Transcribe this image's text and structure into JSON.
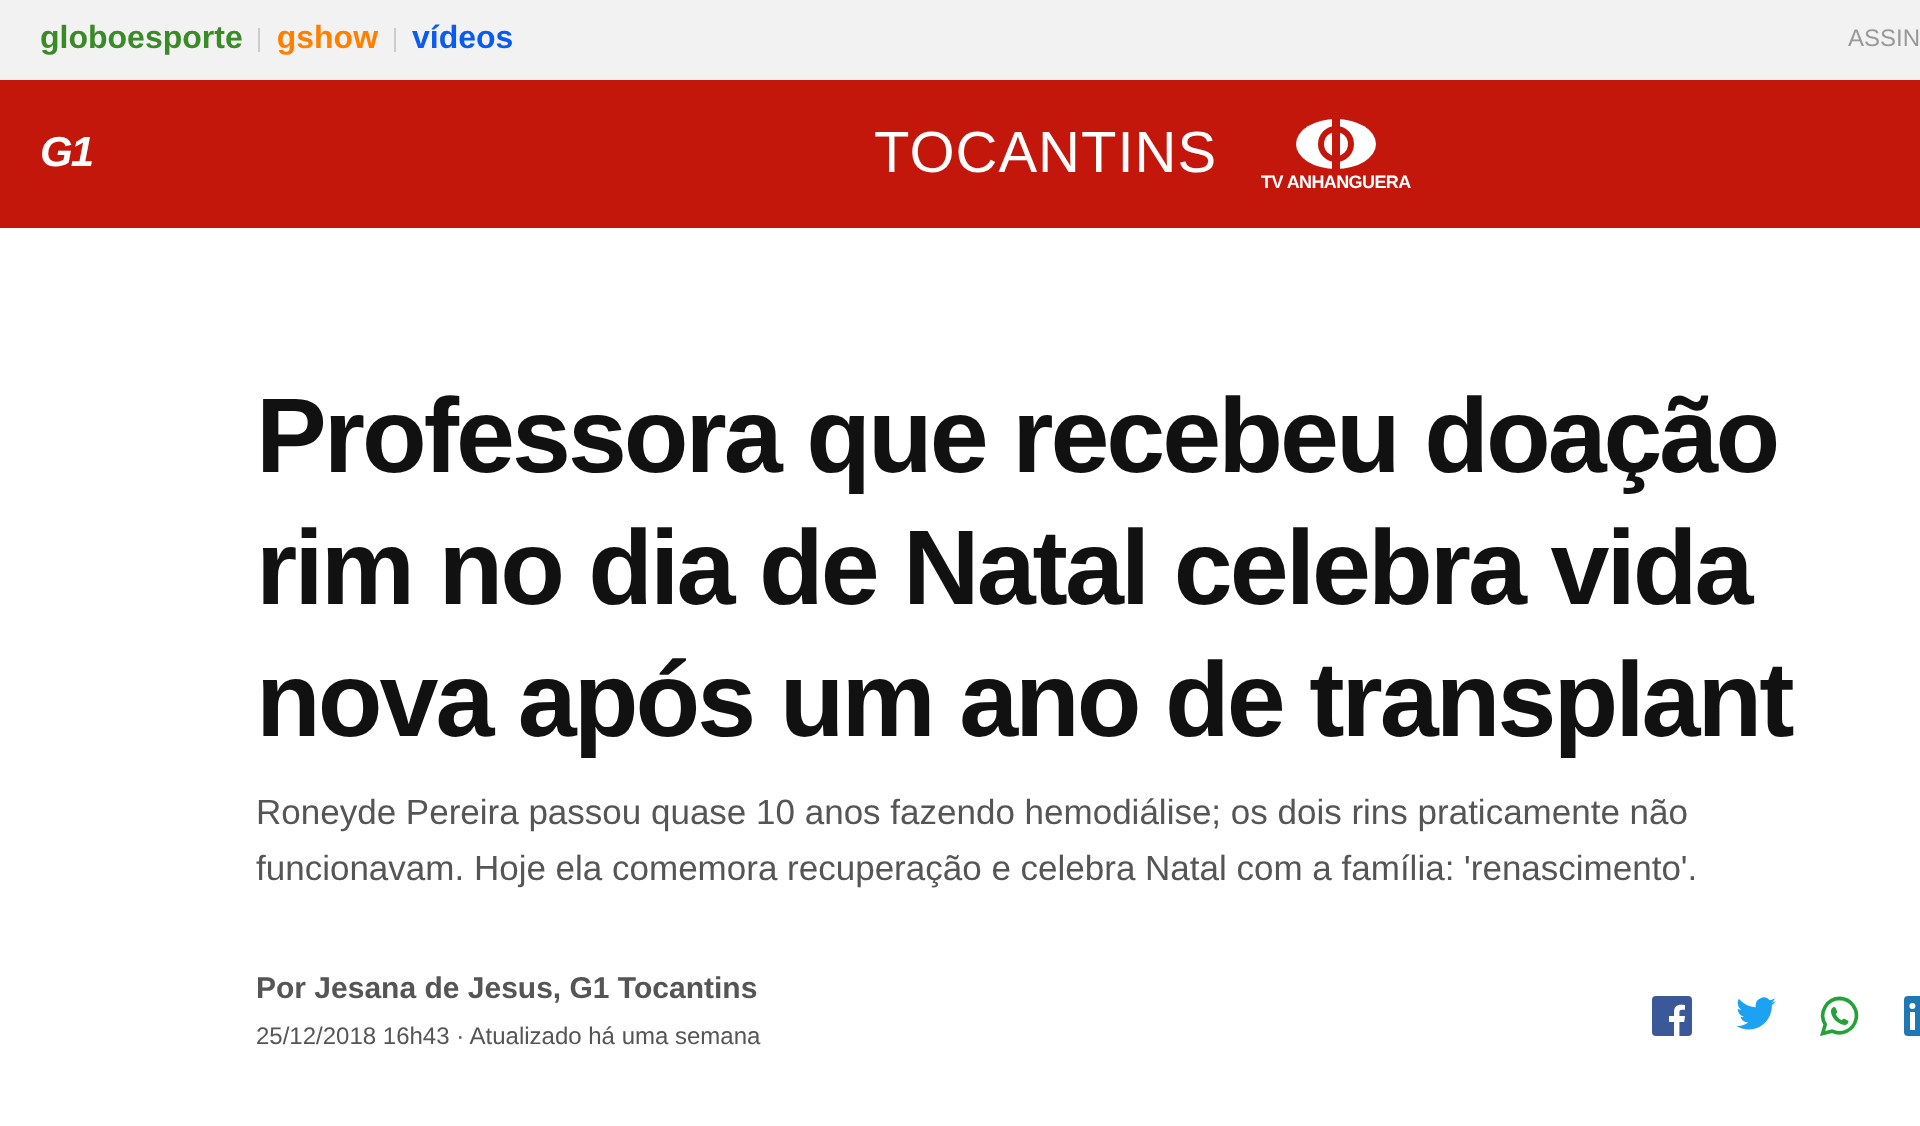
{
  "top_bar": {
    "links": [
      {
        "label": "globoesporte",
        "color": "#3a8a27"
      },
      {
        "label": "gshow",
        "color": "#ff7f00"
      },
      {
        "label": "vídeos",
        "color": "#0b5bf0"
      }
    ],
    "account_link": "ASSIN"
  },
  "header": {
    "logo": "G1",
    "region": "TOCANTINS",
    "station": "TV ANHANGUERA"
  },
  "article": {
    "headline_lines": [
      "Professora que recebeu doação",
      "rim no dia de Natal celebra vida",
      "nova após um ano de transplant"
    ],
    "subtitle": "Roneyde Pereira passou quase 10 anos fazendo hemodiálise; os dois rins praticamente não funcionavam. Hoje ela comemora recuperação e celebra Natal com a família: 'renascimento'.",
    "byline": "Por Jesana de Jesus, G1 Tocantins",
    "date": "25/12/2018 16h43 · Atualizado há uma semana",
    "share": [
      {
        "kind": "facebook"
      },
      {
        "kind": "twitter"
      },
      {
        "kind": "whatsapp"
      },
      {
        "kind": "linkedin"
      }
    ]
  }
}
